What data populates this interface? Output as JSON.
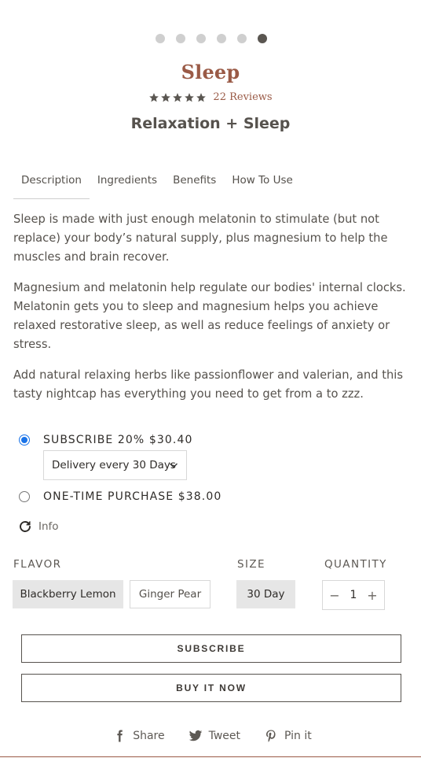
{
  "carousel": {
    "count": 6,
    "active_index": 5
  },
  "product": {
    "title": "Sleep",
    "rating_stars": 5,
    "reviews_text": "22 Reviews",
    "subtitle": "Relaxation + Sleep"
  },
  "tabs": [
    {
      "label": "Description",
      "active": true
    },
    {
      "label": "Ingredients",
      "active": false
    },
    {
      "label": "Benefits",
      "active": false
    },
    {
      "label": "How To Use",
      "active": false
    }
  ],
  "description": [
    "Sleep is made with just enough melatonin to stimulate (but not replace) your body’s natural supply, plus magnesium to help the muscles and brain recover.",
    "Magnesium and melatonin help regulate our bodies' internal clocks. Melatonin gets you to sleep and magnesium helps you achieve relaxed restorative sleep, as well as reduce feelings of anxiety or stress.",
    "Add natural relaxing herbs like passionflower and valerian, and this tasty nightcap has everything you need to get from a to zzz."
  ],
  "purchase": {
    "subscribe_label": "SUBSCRIBE 20% $30.40",
    "subscribe_selected": true,
    "delivery_value": "Delivery every 30 Days",
    "onetime_label": "ONE-TIME PURCHASE $38.00",
    "info_label": "Info"
  },
  "options": {
    "flavor_label": "FLAVOR",
    "flavors": [
      "Blackberry Lemon",
      "Ginger Pear"
    ],
    "selected_flavor": "Blackberry Lemon",
    "size_label": "SIZE",
    "sizes": [
      "30 Day"
    ],
    "quantity_label": "QUANTITY",
    "quantity_value": "1",
    "minus": "−",
    "plus": "+"
  },
  "actions": {
    "subscribe_button": "SUBSCRIBE",
    "buy_now_button": "BUY IT NOW"
  },
  "share": {
    "facebook": "Share",
    "twitter": "Tweet",
    "pinterest": "Pin it"
  },
  "colors": {
    "accent": "#9a5a46",
    "radio_selected": "#1a73e8",
    "text": "#56524d"
  }
}
